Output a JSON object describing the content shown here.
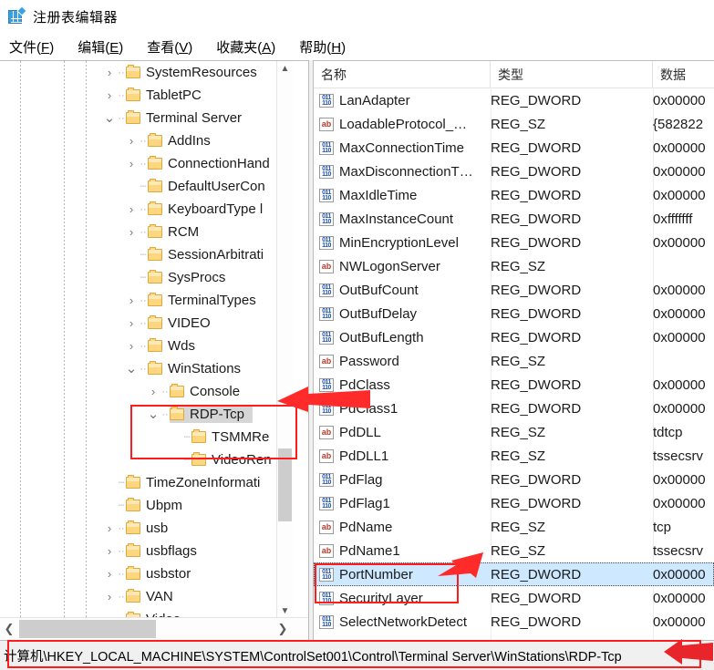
{
  "window": {
    "title": "注册表编辑器",
    "icon": "registry-editor-icon"
  },
  "menu": [
    {
      "label": "文件",
      "accel": "F"
    },
    {
      "label": "编辑",
      "accel": "E"
    },
    {
      "label": "查看",
      "accel": "V"
    },
    {
      "label": "收藏夹",
      "accel": "A"
    },
    {
      "label": "帮助",
      "accel": "H"
    }
  ],
  "tree": {
    "nodes": [
      {
        "label": "SystemResources",
        "indent": 0,
        "state": "collapsed",
        "selected": false
      },
      {
        "label": "TabletPC",
        "indent": 0,
        "state": "collapsed",
        "selected": false
      },
      {
        "label": "Terminal Server",
        "indent": 0,
        "state": "expanded",
        "selected": false
      },
      {
        "label": "AddIns",
        "indent": 1,
        "state": "collapsed",
        "selected": false
      },
      {
        "label": "ConnectionHand",
        "indent": 1,
        "state": "collapsed",
        "selected": false
      },
      {
        "label": "DefaultUserCon",
        "indent": 1,
        "state": "leaf",
        "selected": false
      },
      {
        "label": "KeyboardType l",
        "indent": 1,
        "state": "collapsed",
        "selected": false
      },
      {
        "label": "RCM",
        "indent": 1,
        "state": "collapsed",
        "selected": false
      },
      {
        "label": "SessionArbitrati",
        "indent": 1,
        "state": "leaf",
        "selected": false
      },
      {
        "label": "SysProcs",
        "indent": 1,
        "state": "leaf",
        "selected": false
      },
      {
        "label": "TerminalTypes",
        "indent": 1,
        "state": "collapsed",
        "selected": false
      },
      {
        "label": "VIDEO",
        "indent": 1,
        "state": "collapsed",
        "selected": false
      },
      {
        "label": "Wds",
        "indent": 1,
        "state": "collapsed",
        "selected": false
      },
      {
        "label": "WinStations",
        "indent": 1,
        "state": "expanded",
        "selected": false
      },
      {
        "label": "Console",
        "indent": 2,
        "state": "collapsed",
        "selected": false
      },
      {
        "label": "RDP-Tcp",
        "indent": 2,
        "state": "expanded",
        "selected": true
      },
      {
        "label": "TSMMRe",
        "indent": 3,
        "state": "leaf",
        "selected": false
      },
      {
        "label": "VideoRen",
        "indent": 3,
        "state": "leaf",
        "selected": false
      },
      {
        "label": "TimeZoneInformati",
        "indent": 0,
        "state": "leaf",
        "selected": false
      },
      {
        "label": "Ubpm",
        "indent": 0,
        "state": "leaf",
        "selected": false
      },
      {
        "label": "usb",
        "indent": 0,
        "state": "collapsed",
        "selected": false
      },
      {
        "label": "usbflags",
        "indent": 0,
        "state": "collapsed",
        "selected": false
      },
      {
        "label": "usbstor",
        "indent": 0,
        "state": "collapsed",
        "selected": false
      },
      {
        "label": "VAN",
        "indent": 0,
        "state": "collapsed",
        "selected": false
      },
      {
        "label": "Video",
        "indent": 0,
        "state": "collapsed",
        "selected": false
      }
    ],
    "scroll_up_icon": "chevron-up-icon",
    "scroll_down_icon": "chevron-down-icon",
    "scroll_left_icon": "chevron-left-icon",
    "scroll_right_icon": "chevron-right-icon"
  },
  "list": {
    "columns": [
      "名称",
      "类型",
      "数据"
    ],
    "rows": [
      {
        "name": "LanAdapter",
        "type": "REG_DWORD",
        "data": "0x00000",
        "icon": "dword-value-icon",
        "selected": false
      },
      {
        "name": "LoadableProtocol_…",
        "type": "REG_SZ",
        "data": "{582822",
        "icon": "string-value-icon",
        "selected": false
      },
      {
        "name": "MaxConnectionTime",
        "type": "REG_DWORD",
        "data": "0x00000",
        "icon": "dword-value-icon",
        "selected": false
      },
      {
        "name": "MaxDisconnectionT…",
        "type": "REG_DWORD",
        "data": "0x00000",
        "icon": "dword-value-icon",
        "selected": false
      },
      {
        "name": "MaxIdleTime",
        "type": "REG_DWORD",
        "data": "0x00000",
        "icon": "dword-value-icon",
        "selected": false
      },
      {
        "name": "MaxInstanceCount",
        "type": "REG_DWORD",
        "data": "0xfffffff",
        "icon": "dword-value-icon",
        "selected": false
      },
      {
        "name": "MinEncryptionLevel",
        "type": "REG_DWORD",
        "data": "0x00000",
        "icon": "dword-value-icon",
        "selected": false
      },
      {
        "name": "NWLogonServer",
        "type": "REG_SZ",
        "data": "",
        "icon": "string-value-icon",
        "selected": false
      },
      {
        "name": "OutBufCount",
        "type": "REG_DWORD",
        "data": "0x00000",
        "icon": "dword-value-icon",
        "selected": false
      },
      {
        "name": "OutBufDelay",
        "type": "REG_DWORD",
        "data": "0x00000",
        "icon": "dword-value-icon",
        "selected": false
      },
      {
        "name": "OutBufLength",
        "type": "REG_DWORD",
        "data": "0x00000",
        "icon": "dword-value-icon",
        "selected": false
      },
      {
        "name": "Password",
        "type": "REG_SZ",
        "data": "",
        "icon": "string-value-icon",
        "selected": false
      },
      {
        "name": "PdClass",
        "type": "REG_DWORD",
        "data": "0x00000",
        "icon": "dword-value-icon",
        "selected": false
      },
      {
        "name": "PdClass1",
        "type": "REG_DWORD",
        "data": "0x00000",
        "icon": "dword-value-icon",
        "selected": false
      },
      {
        "name": "PdDLL",
        "type": "REG_SZ",
        "data": "tdtcp",
        "icon": "string-value-icon",
        "selected": false
      },
      {
        "name": "PdDLL1",
        "type": "REG_SZ",
        "data": "tssecsrv",
        "icon": "string-value-icon",
        "selected": false
      },
      {
        "name": "PdFlag",
        "type": "REG_DWORD",
        "data": "0x00000",
        "icon": "dword-value-icon",
        "selected": false
      },
      {
        "name": "PdFlag1",
        "type": "REG_DWORD",
        "data": "0x00000",
        "icon": "dword-value-icon",
        "selected": false
      },
      {
        "name": "PdName",
        "type": "REG_SZ",
        "data": "tcp",
        "icon": "string-value-icon",
        "selected": false
      },
      {
        "name": "PdName1",
        "type": "REG_SZ",
        "data": "tssecsrv",
        "icon": "string-value-icon",
        "selected": false
      },
      {
        "name": "PortNumber",
        "type": "REG_DWORD",
        "data": "0x00000",
        "icon": "dword-value-icon",
        "selected": true
      },
      {
        "name": "SecurityLayer",
        "type": "REG_DWORD",
        "data": "0x00000",
        "icon": "dword-value-icon",
        "selected": false
      },
      {
        "name": "SelectNetworkDetect",
        "type": "REG_DWORD",
        "data": "0x00000",
        "icon": "dword-value-icon",
        "selected": false
      }
    ]
  },
  "statusbar": {
    "path": "计算机\\HKEY_LOCAL_MACHINE\\SYSTEM\\ControlSet001\\Control\\Terminal Server\\WinStations\\RDP-Tcp"
  },
  "annotations": {
    "color": "#ff1c1c",
    "boxes": [
      {
        "name": "tree-winstations-highlight-box"
      },
      {
        "name": "portnumber-highlight-box"
      },
      {
        "name": "statusbar-path-highlight-box"
      }
    ],
    "arrows": [
      {
        "name": "arrow-to-tree-nodes"
      },
      {
        "name": "arrow-to-portnumber"
      },
      {
        "name": "arrow-to-statusbar-path"
      }
    ]
  }
}
